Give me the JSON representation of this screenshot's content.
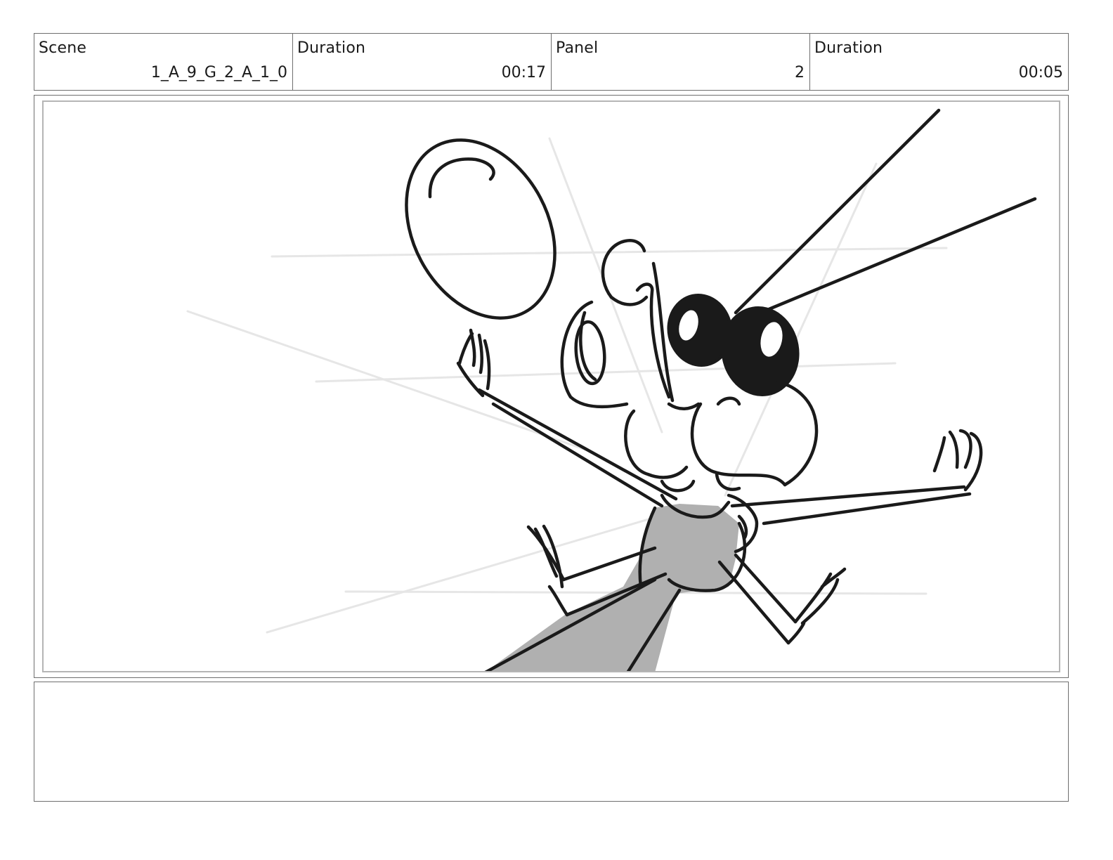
{
  "header": {
    "scene_label": "Scene",
    "scene_value": "1_A_9_G_2_A_1_0",
    "scene_duration_label": "Duration",
    "scene_duration_value": "00:17",
    "panel_label": "Panel",
    "panel_value": "2",
    "panel_duration_label": "Duration",
    "panel_duration_value": "00:05"
  },
  "notes": {
    "text": ""
  },
  "colors": {
    "ink": "#1a1a1a",
    "body_fill": "#b0b0b0",
    "construction_lines": "#e6e6e6"
  }
}
